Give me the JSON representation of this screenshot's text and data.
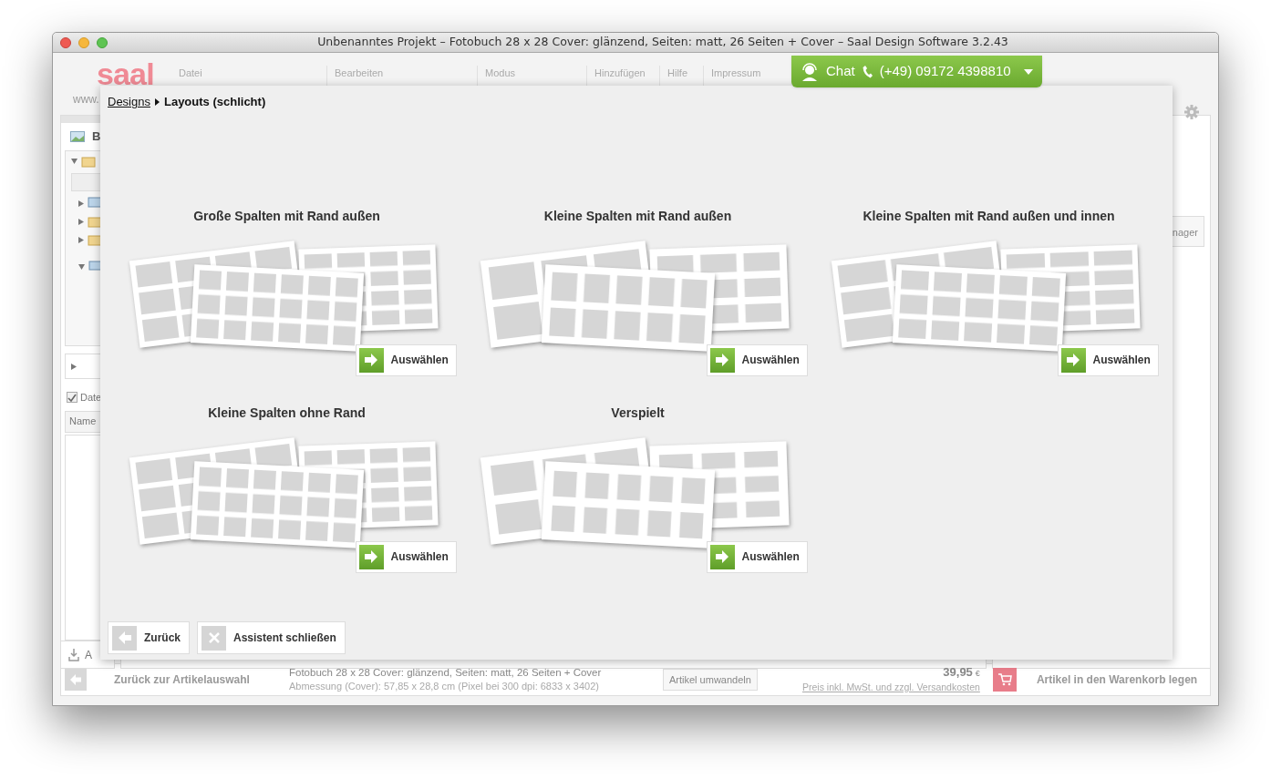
{
  "window": {
    "title": "Unbenanntes Projekt – Fotobuch 28 x 28 Cover: glänzend, Seiten: matt, 26 Seiten + Cover – Saal Design Software 3.2.43"
  },
  "toolbar": {
    "logo": "saal",
    "logo_url": "www.",
    "menus": [
      "Datei",
      "Bearbeiten",
      "Modus",
      "Hinzufügen",
      "Hilfe",
      "Impressum"
    ],
    "chat_button": {
      "label": "Chat",
      "phone": "(+49) 09172 4398810"
    }
  },
  "sidebar": {
    "panel_title": "B",
    "checkbox": {
      "label": "Date",
      "checked": true
    },
    "column_header": "Name",
    "bottom_label": "A"
  },
  "right_panel": {
    "button": "nager"
  },
  "dialog": {
    "breadcrumb": [
      {
        "label": "Designs",
        "kind": "link"
      },
      {
        "label": "Layouts (schlicht)",
        "kind": "current"
      }
    ],
    "layouts": [
      {
        "title": "Große Spalten mit Rand außen",
        "button": "Auswählen"
      },
      {
        "title": "Kleine Spalten mit Rand außen",
        "button": "Auswählen"
      },
      {
        "title": "Kleine Spalten mit Rand außen und innen",
        "button": "Auswählen"
      },
      {
        "title": "Kleine Spalten ohne Rand",
        "button": "Auswählen"
      },
      {
        "title": "Verspielt",
        "button": "Auswählen"
      }
    ],
    "buttons": [
      {
        "kind": "back",
        "label": "Zurück"
      },
      {
        "kind": "close",
        "label": "Assistent schließen"
      }
    ]
  },
  "bottom_bar": {
    "back_button": "Zurück zur Artikelauswahl",
    "product": "Fotobuch 28 x 28 Cover: glänzend, Seiten: matt, 26 Seiten + Cover",
    "dimensions": "Abmessung (Cover): 57,85 x 28,8 cm (Pixel bei 300 dpi: 6833 x 3402)",
    "convert_button": "Artikel umwandeln",
    "price": "39,95",
    "currency": "€",
    "price_note": "Preis inkl. MwSt. und zzgl. Versandkosten",
    "cart_button": "Artikel in den Warenkorb legen"
  }
}
